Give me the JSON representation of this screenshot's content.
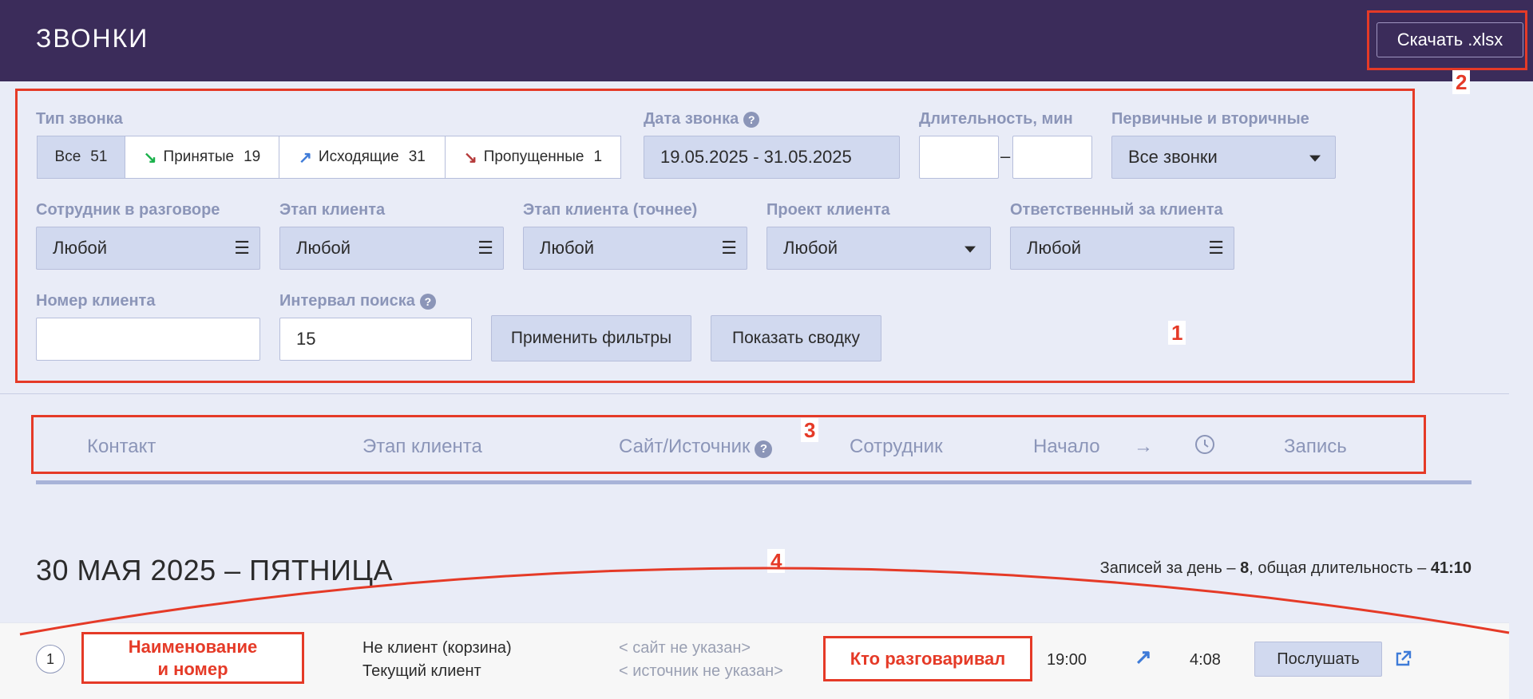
{
  "header": {
    "title": "ЗВОНКИ",
    "download_label": "Скачать .xlsx"
  },
  "annotations": {
    "n1": "1",
    "n2": "2",
    "n3": "3",
    "n4": "4",
    "contact_box": "Наименование\nи номер",
    "employee_box": "Кто разговаривал"
  },
  "filters": {
    "call_type": {
      "label": "Тип звонка",
      "options": [
        {
          "label": "Все",
          "count": "51",
          "icon": "none"
        },
        {
          "label": "Принятые",
          "count": "19",
          "icon": "incoming-arrow",
          "color": "#19b14a"
        },
        {
          "label": "Исходящие",
          "count": "31",
          "icon": "outgoing-arrow",
          "color": "#3e7bd8"
        },
        {
          "label": "Пропущенные",
          "count": "1",
          "icon": "missed-arrow",
          "color": "#b53a3a"
        }
      ]
    },
    "date": {
      "label": "Дата звонка",
      "value": "19.05.2025 - 31.05.2025"
    },
    "duration": {
      "label": "Длительность, мин",
      "separator": "–"
    },
    "primary": {
      "label": "Первичные и вторичные",
      "value": "Все звонки"
    },
    "employee": {
      "label": "Сотрудник в разговоре",
      "value": "Любой"
    },
    "client_stage": {
      "label": "Этап клиента",
      "value": "Любой"
    },
    "client_stage_exact": {
      "label": "Этап клиента (точнее)",
      "value": "Любой"
    },
    "client_project": {
      "label": "Проект клиента",
      "value": "Любой"
    },
    "responsible": {
      "label": "Ответственный за клиента",
      "value": "Любой"
    },
    "client_number": {
      "label": "Номер клиента",
      "value": ""
    },
    "search_interval": {
      "label": "Интервал поиска",
      "value": "15"
    },
    "apply_label": "Применить фильтры",
    "summary_label": "Показать сводку"
  },
  "columns": {
    "contact": "Контакт",
    "stage": "Этап клиента",
    "source": "Сайт/Источник",
    "employee": "Сотрудник",
    "start": "Начало",
    "arrow": "→",
    "record": "Запись"
  },
  "day": {
    "title": "30 МАЯ 2025 – ПЯТНИЦА",
    "summary_prefix": "Записей за день – ",
    "records": "8",
    "summary_mid": ", общая длительность – ",
    "duration": "41:10"
  },
  "row": {
    "index": "1",
    "stage_line1": "Не клиент (корзина)",
    "stage_line2": "Текущий клиент",
    "site": "< сайт не указан>",
    "source": "< источник не указан>",
    "time": "19:00",
    "duration": "4:08",
    "listen_label": "Послушать"
  },
  "colors": {
    "header_bg": "#3b2c5a",
    "page_bg": "#e9ecf7",
    "control_bg": "#d1d9ef",
    "label_color": "#8b95b8",
    "annotation_red": "#e53a27"
  }
}
